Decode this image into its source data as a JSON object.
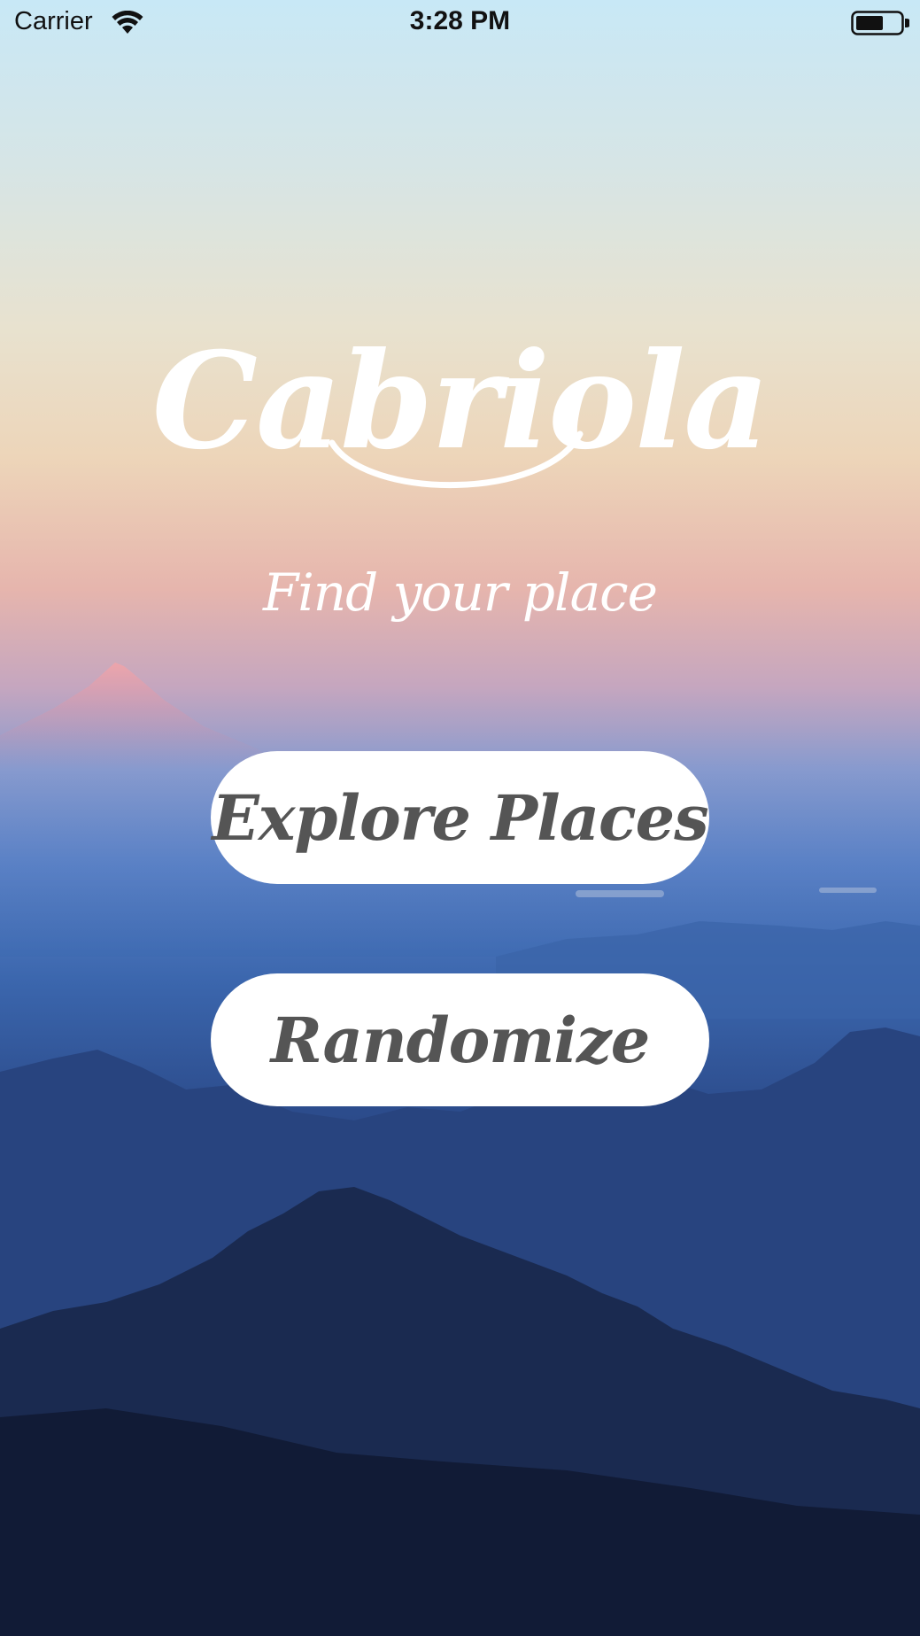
{
  "status_bar": {
    "carrier": "Carrier",
    "time": "3:28 PM",
    "wifi_icon": "wifi-icon",
    "battery_icon": "battery-icon"
  },
  "app": {
    "title": "Cabriola",
    "tagline": "Find your place"
  },
  "buttons": {
    "explore_label": "Explore Places",
    "randomize_label": "Randomize"
  },
  "colors": {
    "button_background": "#ffffff",
    "button_text": "#555555",
    "title_text": "#ffffff",
    "sky_top": "#c8e8f6",
    "sky_middle": "#e6b5ad",
    "mountains": "#162449"
  }
}
